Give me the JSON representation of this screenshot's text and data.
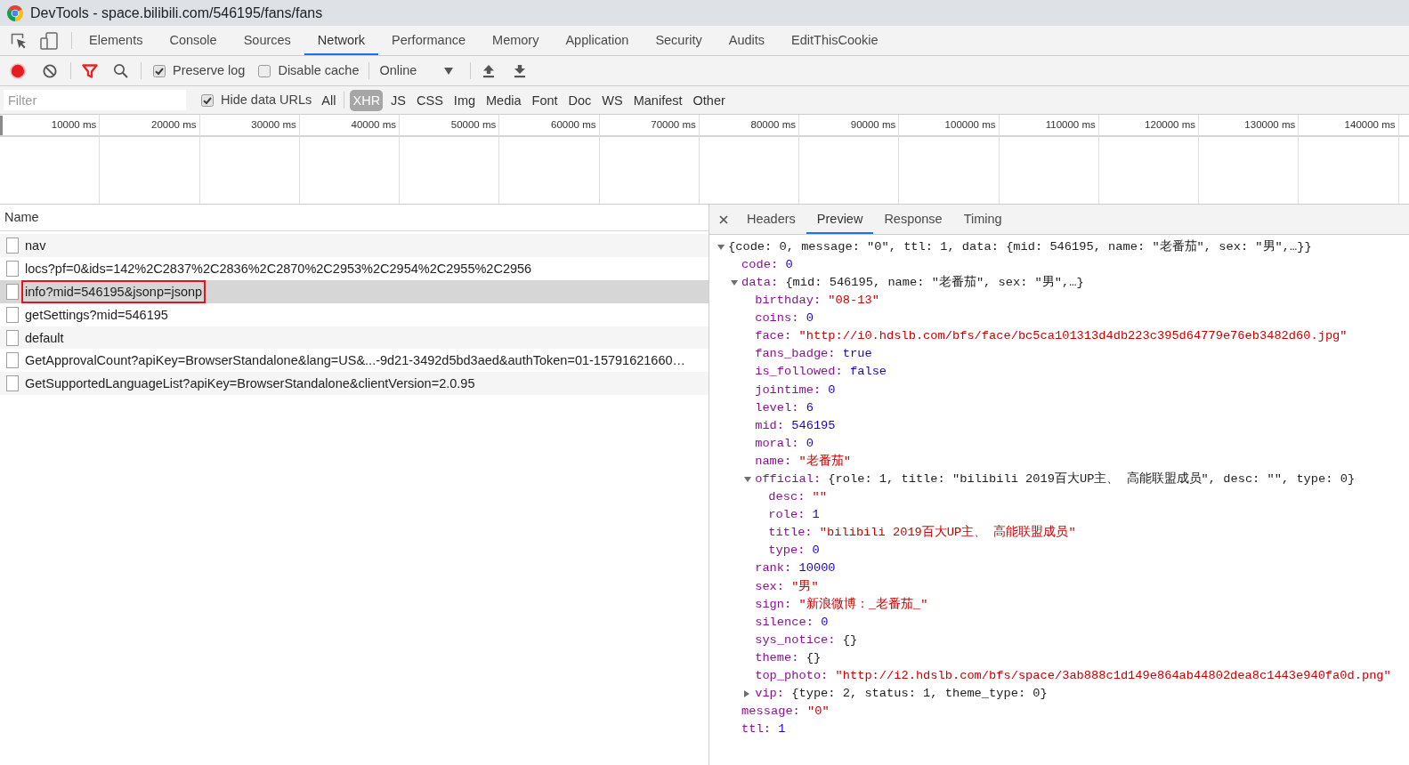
{
  "window": {
    "title": "DevTools - space.bilibili.com/546195/fans/fans"
  },
  "panel_tabs": [
    {
      "label": "Elements",
      "selected": false
    },
    {
      "label": "Console",
      "selected": false
    },
    {
      "label": "Sources",
      "selected": false
    },
    {
      "label": "Network",
      "selected": true
    },
    {
      "label": "Performance",
      "selected": false
    },
    {
      "label": "Memory",
      "selected": false
    },
    {
      "label": "Application",
      "selected": false
    },
    {
      "label": "Security",
      "selected": false
    },
    {
      "label": "Audits",
      "selected": false
    },
    {
      "label": "EditThisCookie",
      "selected": false
    }
  ],
  "toolbar": {
    "recording": true,
    "filter_active": true,
    "options": [
      {
        "label": "Preserve log",
        "checked": true
      },
      {
        "label": "Disable cache",
        "checked": false
      }
    ],
    "throttling": "Online"
  },
  "filter_bar": {
    "placeholder": "Filter",
    "hide_data_urls": {
      "label": "Hide data URLs",
      "checked": true
    },
    "types": [
      {
        "label": "All",
        "selected": false
      },
      {
        "label": "XHR",
        "selected": true
      },
      {
        "label": "JS",
        "selected": false
      },
      {
        "label": "CSS",
        "selected": false
      },
      {
        "label": "Img",
        "selected": false
      },
      {
        "label": "Media",
        "selected": false
      },
      {
        "label": "Font",
        "selected": false
      },
      {
        "label": "Doc",
        "selected": false
      },
      {
        "label": "WS",
        "selected": false
      },
      {
        "label": "Manifest",
        "selected": false
      },
      {
        "label": "Other",
        "selected": false
      }
    ]
  },
  "timeline": {
    "ticks": [
      "10000 ms",
      "20000 ms",
      "30000 ms",
      "40000 ms",
      "50000 ms",
      "60000 ms",
      "70000 ms",
      "80000 ms",
      "90000 ms",
      "100000 ms",
      "110000 ms",
      "120000 ms",
      "130000 ms",
      "140000 ms"
    ]
  },
  "requests": {
    "column": "Name",
    "rows": [
      {
        "name": "nav",
        "selected": false,
        "outlined": false
      },
      {
        "name": "locs?pf=0&ids=142%2C2837%2C2836%2C2870%2C2953%2C2954%2C2955%2C2956",
        "selected": false,
        "outlined": false
      },
      {
        "name": "info?mid=546195&jsonp=jsonp",
        "selected": true,
        "outlined": true
      },
      {
        "name": "getSettings?mid=546195",
        "selected": false,
        "outlined": false
      },
      {
        "name": "default",
        "selected": false,
        "outlined": false
      },
      {
        "name": "GetApprovalCount?apiKey=BrowserStandalone&lang=US&...-9d21-3492d5bd3aed&authToken=01-15791621660…",
        "selected": false,
        "outlined": false
      },
      {
        "name": "GetSupportedLanguageList?apiKey=BrowserStandalone&clientVersion=2.0.95",
        "selected": false,
        "outlined": false
      }
    ]
  },
  "details": {
    "tabs": [
      {
        "label": "Headers",
        "selected": false
      },
      {
        "label": "Preview",
        "selected": true
      },
      {
        "label": "Response",
        "selected": false
      },
      {
        "label": "Timing",
        "selected": false
      }
    ],
    "preview": {
      "value": "{code: 0, message: \"0\", ttl: 1, data: {mid: 546195, name: \"老番茄\", sex: \"男\",…}}",
      "kind": "object",
      "expanded": true,
      "children": [
        {
          "key": "code:",
          "value": "0",
          "kind": "number"
        },
        {
          "key": "data:",
          "value": "{mid: 546195, name: \"老番茄\", sex: \"男\",…}",
          "kind": "object",
          "expanded": true,
          "children": [
            {
              "key": "birthday:",
              "value": "\"08-13\"",
              "kind": "string"
            },
            {
              "key": "coins:",
              "value": "0",
              "kind": "number"
            },
            {
              "key": "face:",
              "value": "\"http://i0.hdslb.com/bfs/face/bc5ca101313d4db223c395d64779e76eb3482d60.jpg\"",
              "kind": "string"
            },
            {
              "key": "fans_badge:",
              "value": "true",
              "kind": "boolean"
            },
            {
              "key": "is_followed:",
              "value": "false",
              "kind": "boolean"
            },
            {
              "key": "jointime:",
              "value": "0",
              "kind": "number"
            },
            {
              "key": "level:",
              "value": "6",
              "kind": "number"
            },
            {
              "key": "mid:",
              "value": "546195",
              "kind": "number"
            },
            {
              "key": "moral:",
              "value": "0",
              "kind": "number"
            },
            {
              "key": "name:",
              "value": "\"老番茄\"",
              "kind": "string"
            },
            {
              "key": "official:",
              "value": "{role: 1, title: \"bilibili 2019百大UP主、 高能联盟成员\", desc: \"\", type: 0}",
              "kind": "object",
              "expanded": true,
              "children": [
                {
                  "key": "desc:",
                  "value": "\"\"",
                  "kind": "string"
                },
                {
                  "key": "role:",
                  "value": "1",
                  "kind": "number"
                },
                {
                  "key": "title:",
                  "value": "\"bilibili 2019百大UP主、 高能联盟成员\"",
                  "kind": "string"
                },
                {
                  "key": "type:",
                  "value": "0",
                  "kind": "number"
                }
              ]
            },
            {
              "key": "rank:",
              "value": "10000",
              "kind": "number"
            },
            {
              "key": "sex:",
              "value": "\"男\"",
              "kind": "string"
            },
            {
              "key": "sign:",
              "value": "\"新浪微博：_老番茄_\"",
              "kind": "string"
            },
            {
              "key": "silence:",
              "value": "0",
              "kind": "number"
            },
            {
              "key": "sys_notice:",
              "value": "{}",
              "kind": "empty"
            },
            {
              "key": "theme:",
              "value": "{}",
              "kind": "empty"
            },
            {
              "key": "top_photo:",
              "value": "\"http://i2.hdslb.com/bfs/space/3ab888c1d149e864ab44802dea8c1443e940fa0d.png\"",
              "kind": "string"
            },
            {
              "key": "vip:",
              "value": "{type: 2, status: 1, theme_type: 0}",
              "kind": "object",
              "expanded": false
            }
          ]
        },
        {
          "key": "message:",
          "value": "\"0\"",
          "kind": "string"
        },
        {
          "key": "ttl:",
          "value": "1",
          "kind": "number"
        }
      ]
    }
  }
}
